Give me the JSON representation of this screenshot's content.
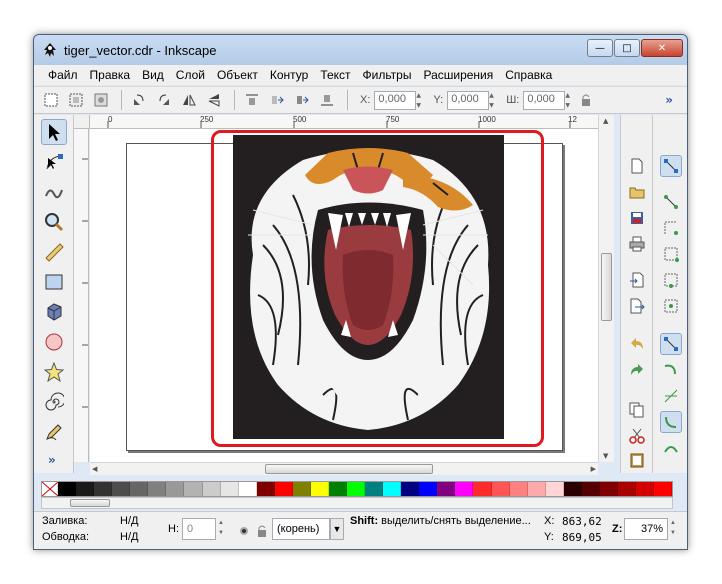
{
  "window": {
    "title": "tiger_vector.cdr - Inkscape",
    "buttons": {
      "minimize": "—",
      "maximize": "□",
      "close": "✕"
    }
  },
  "menu": [
    "Файл",
    "Правка",
    "Вид",
    "Слой",
    "Объект",
    "Контур",
    "Текст",
    "Фильтры",
    "Расширения",
    "Справка"
  ],
  "command_bar": {
    "x_label": "X:",
    "x_value": "0,000",
    "y_label": "Y:",
    "y_value": "0,000",
    "w_label": "Ш:",
    "w_value": "0,000",
    "more": "»"
  },
  "rulers": {
    "horizontal": [
      "0",
      "250",
      "500",
      "750",
      "1000",
      "12"
    ],
    "vertical": [
      "0",
      "250",
      "500",
      "750",
      "1000"
    ]
  },
  "tools": [
    "selector-tool",
    "node-tool",
    "tweak-tool",
    "zoom-tool",
    "measure-tool",
    "rectangle-tool",
    "3dbox-tool",
    "ellipse-tool",
    "star-tool",
    "spiral-tool",
    "pencil-tool"
  ],
  "toolbox_more": "»",
  "palette_colors": [
    "#000000",
    "#1a1a1a",
    "#333333",
    "#4d4d4d",
    "#666666",
    "#808080",
    "#999999",
    "#b3b3b3",
    "#cccccc",
    "#e6e6e6",
    "#ffffff",
    "#800000",
    "#ff0000",
    "#808000",
    "#ffff00",
    "#008000",
    "#00ff00",
    "#008080",
    "#00ffff",
    "#000080",
    "#0000ff",
    "#800080",
    "#ff00ff",
    "#ff2a2a",
    "#ff5555",
    "#ff8080",
    "#ffaaaa",
    "#ffd5d5",
    "#2b0000",
    "#550000",
    "#800000",
    "#aa0000",
    "#d40000",
    "#ff0000"
  ],
  "status": {
    "fill_label": "Заливка:",
    "fill_value": "Н/Д",
    "stroke_label": "Обводка:",
    "stroke_value": "Н/Д",
    "h_label": "Н:",
    "h_value": "0",
    "layer_value": "(корень)",
    "message_bold": "Shift:",
    "message": " выделить/снять выделение...",
    "x_label": "X:",
    "x_value": "863,62",
    "y_label": "Y:",
    "y_value": "869,05",
    "zoom_label": "Z:",
    "zoom_value": "37%"
  },
  "colors": {
    "highlight": "#e0191f",
    "artwork_background": "#231f20",
    "chrome": "#f0f0f0"
  }
}
